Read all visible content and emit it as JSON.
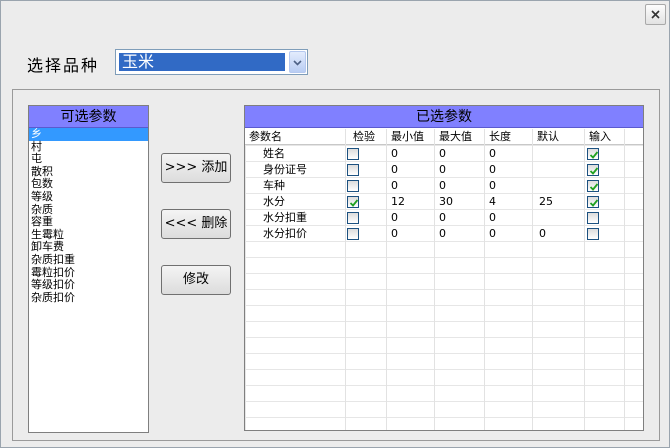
{
  "window": {
    "close_icon": "close-icon"
  },
  "variety": {
    "label": "选择品种",
    "selected": "玉米"
  },
  "available": {
    "header": "可选参数",
    "items": [
      "乡",
      "村",
      "屯",
      "散积",
      "包数",
      "等级",
      "杂质",
      "容重",
      "生霉粒",
      "卸车费",
      "杂质扣重",
      "霉粒扣价",
      "等级扣价",
      "杂质扣价"
    ],
    "selected_index": 0
  },
  "buttons": {
    "add": ">>> 添加",
    "delete": "<<< 删除",
    "modify": "修改"
  },
  "chosen": {
    "header": "已选参数",
    "columns": [
      "参数名",
      "检验",
      "最小值",
      "最大值",
      "长度",
      "默认",
      "输入"
    ],
    "rows": [
      {
        "name": "姓名",
        "check": false,
        "min": "0",
        "max": "0",
        "len": "0",
        "default": "",
        "input": true
      },
      {
        "name": "身份证号",
        "check": false,
        "min": "0",
        "max": "0",
        "len": "0",
        "default": "",
        "input": true
      },
      {
        "name": "车种",
        "check": false,
        "min": "0",
        "max": "0",
        "len": "0",
        "default": "",
        "input": true
      },
      {
        "name": "水分",
        "check": true,
        "min": "12",
        "max": "30",
        "len": "4",
        "default": "25",
        "input": true
      },
      {
        "name": "水分扣重",
        "check": false,
        "min": "0",
        "max": "0",
        "len": "0",
        "default": "",
        "input": false
      },
      {
        "name": "水分扣价",
        "check": false,
        "min": "0",
        "max": "0",
        "len": "0",
        "default": "0",
        "input": false
      }
    ]
  },
  "colors": {
    "header_bg": "#8080ff",
    "selection": "#3399ff",
    "combo_selection": "#316ac5",
    "check": "#21a121"
  }
}
